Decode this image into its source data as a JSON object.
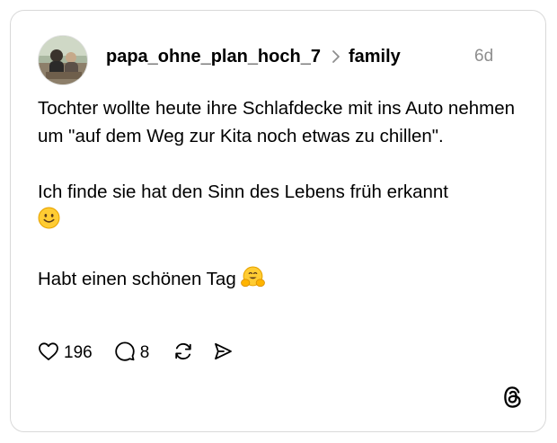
{
  "post": {
    "author": "papa_ohne_plan_hoch_7",
    "community": "family",
    "time": "6d",
    "body": {
      "para1": "Tochter wollte heute ihre Schlafdecke mit ins Auto nehmen um \"auf dem Weg zur Kita noch etwas zu chillen\".",
      "para2": "Ich finde sie hat den Sinn des Lebens früh erkannt",
      "para3": "Habt einen schönen Tag"
    },
    "stats": {
      "likes": "196",
      "replies": "8"
    },
    "icons": {
      "like": "heart-icon",
      "reply": "comment-icon",
      "repost": "repost-icon",
      "share": "share-icon",
      "brand": "threads-logo-icon",
      "separator": "chevron-right-icon"
    }
  }
}
